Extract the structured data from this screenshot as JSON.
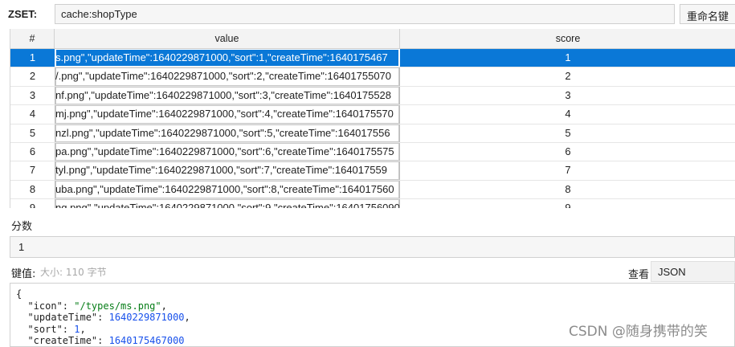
{
  "header": {
    "type_label": "ZSET:",
    "key_value": "cache:shopType",
    "rename_label": "重命名键"
  },
  "table": {
    "columns": [
      "#",
      "value",
      "score"
    ],
    "rows": [
      {
        "index": "1",
        "value": "s.png\",\"updateTime\":1640229871000,\"sort\":1,\"createTime\":1640175467",
        "score": "1"
      },
      {
        "index": "2",
        "value": "/.png\",\"updateTime\":1640229871000,\"sort\":2,\"createTime\":16401755070",
        "score": "2"
      },
      {
        "index": "3",
        "value": "nf.png\",\"updateTime\":1640229871000,\"sort\":3,\"createTime\":1640175528",
        "score": "3"
      },
      {
        "index": "4",
        "value": "mj.png\",\"updateTime\":1640229871000,\"sort\":4,\"createTime\":1640175570",
        "score": "4"
      },
      {
        "index": "5",
        "value": "nzl.png\",\"updateTime\":1640229871000,\"sort\":5,\"createTime\":164017556",
        "score": "5"
      },
      {
        "index": "6",
        "value": "pa.png\",\"updateTime\":1640229871000,\"sort\":6,\"createTime\":1640175575",
        "score": "6"
      },
      {
        "index": "7",
        "value": "tyl.png\",\"updateTime\":1640229871000,\"sort\":7,\"createTime\":164017559",
        "score": "7"
      },
      {
        "index": "8",
        "value": "uba.png\",\"updateTime\":1640229871000,\"sort\":8,\"createTime\":164017560",
        "score": "8"
      },
      {
        "index": "9",
        "value": "ng.png\",\"updateTime\":1640229871000,\"sort\":9,\"createTime\":16401756090",
        "score": "9"
      }
    ],
    "selected_index": 0
  },
  "score_section": {
    "label": "分数",
    "value": "1"
  },
  "value_section": {
    "label": "键值:",
    "size_text": "大小: 110 字节",
    "view_label": "查看",
    "format": "JSON"
  },
  "editor": {
    "lines": [
      [
        {
          "t": "{",
          "k": "p"
        }
      ],
      [
        {
          "t": "  \"icon\": ",
          "k": "p"
        },
        {
          "t": "\"/types/ms.png\"",
          "k": "s"
        },
        {
          "t": ",",
          "k": "p"
        }
      ],
      [
        {
          "t": "  \"updateTime\": ",
          "k": "p"
        },
        {
          "t": "1640229871000",
          "k": "n"
        },
        {
          "t": ",",
          "k": "p"
        }
      ],
      [
        {
          "t": "  \"sort\": ",
          "k": "p"
        },
        {
          "t": "1",
          "k": "n"
        },
        {
          "t": ",",
          "k": "p"
        }
      ],
      [
        {
          "t": "  \"createTime\": ",
          "k": "p"
        },
        {
          "t": "1640175467000",
          "k": "n"
        }
      ]
    ]
  },
  "watermark": "CSDN @随身携带的笑",
  "colors": {
    "selection": "#0a78d7",
    "json_string": "#067d17",
    "json_number": "#1750eb"
  }
}
